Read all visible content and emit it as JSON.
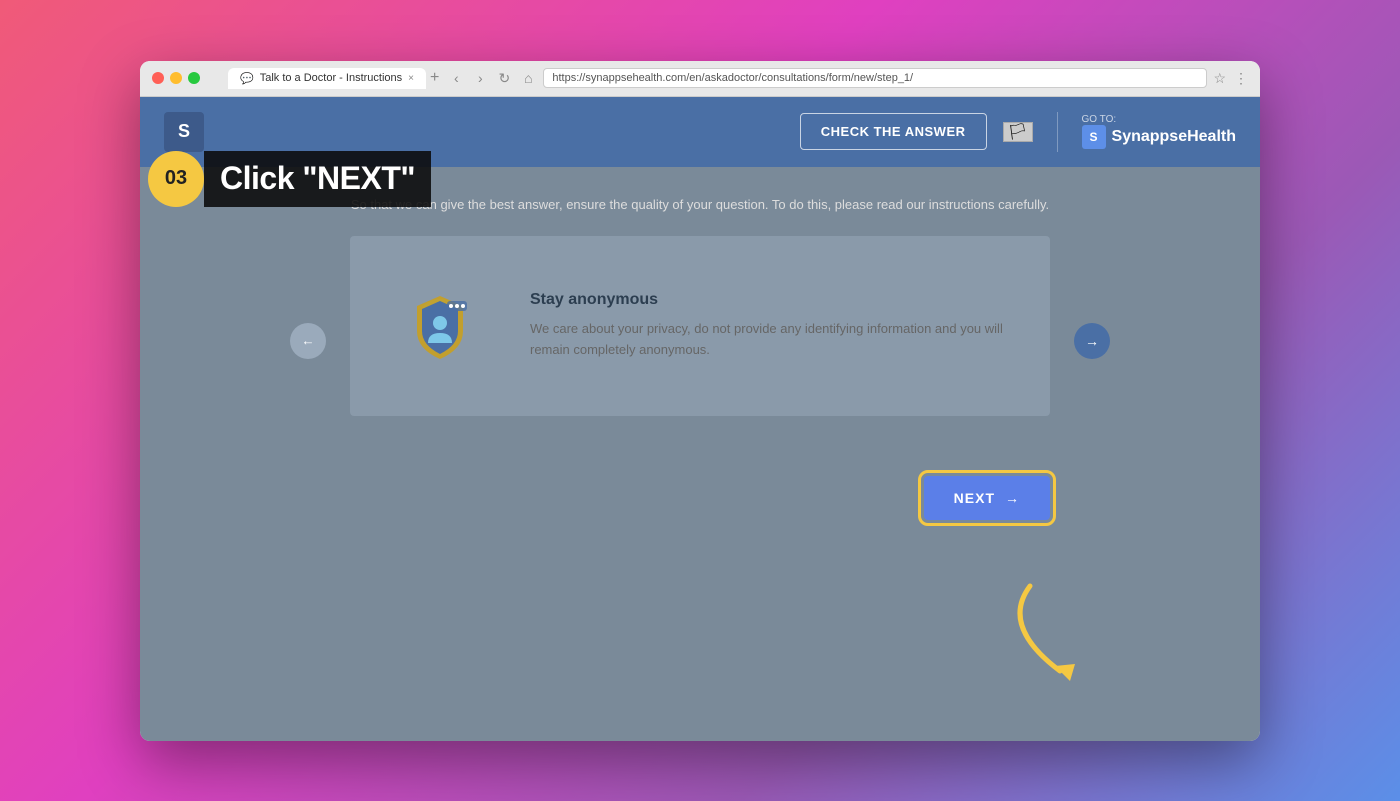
{
  "browser": {
    "tab_title": "Talk to a Doctor - Instructions",
    "url": "https://synappsehealth.com/en/askadoctor/consultations/form/new/step_1/",
    "favicon": "💬"
  },
  "header": {
    "logo_letter": "S",
    "check_answer_label": "CHECK THE ANSWER",
    "goto_label": "GO TO:",
    "brand_name": "SynappseHealth",
    "brand_icon": "S"
  },
  "content": {
    "instruction": "So that we can give the best answer, ensure the quality of your question. To do this, please read our instructions carefully.",
    "card": {
      "title": "Stay anonymous",
      "description": "We care about your privacy, do not provide any identifying information and you will remain completely anonymous."
    },
    "next_button": "NEXT"
  },
  "annotation": {
    "step_number": "03",
    "step_label": "Click \"NEXT\""
  },
  "colors": {
    "header_bg": "#4a6fa5",
    "content_bg": "#7a8a99",
    "card_bg": "#8a9aaa",
    "next_btn_bg": "#5b7fe8",
    "arrow_color": "#f5c842",
    "badge_color": "#f5c842"
  }
}
